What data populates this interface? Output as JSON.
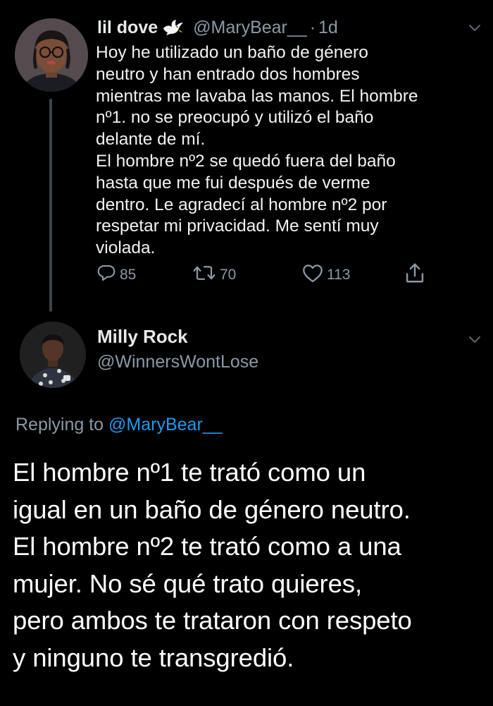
{
  "original_tweet": {
    "display_name": "lil dove",
    "handle": "@MaryBear__",
    "separator": "·",
    "time": "1d",
    "body_lines": [
      "Hoy he utilizado un baño de género",
      "neutro y han entrado dos hombres",
      "mientras me lavaba las manos. El hombre",
      "nº1. no se preocupó y utilizó el baño",
      "delante de mí.",
      "El hombre nº2 se quedó fuera del baño",
      "hasta que me fui después de verme",
      "dentro. Le agradecí al hombre nº2 por",
      "respetar mi privacidad. Me sentí muy",
      "violada."
    ],
    "reply_count": "85",
    "retweet_count": "70",
    "like_count": "113",
    "icons": [
      "dove-emoji-icon",
      "reply-icon",
      "retweet-icon",
      "like-icon",
      "share-icon",
      "chevron-down-icon"
    ]
  },
  "reply_tweet": {
    "display_name": "Milly Rock",
    "handle": "@WinnersWontLose",
    "replying_to_prefix": "Replying to",
    "replying_to_handle": "@MaryBear__",
    "body_lines": [
      "El hombre nº1 te trató como un",
      "igual en un baño de género neutro.",
      "El hombre nº2 te trató como a una",
      "mujer. No sé qué trato quieres,",
      "pero ambos te trataron con respeto",
      "y ninguno te transgredió."
    ]
  },
  "colors": {
    "background": "#000000",
    "primary_text": "#e7e9ea",
    "secondary_text": "#8b98a5",
    "link": "#1d9bf0",
    "thread_line": "#3d4247"
  }
}
